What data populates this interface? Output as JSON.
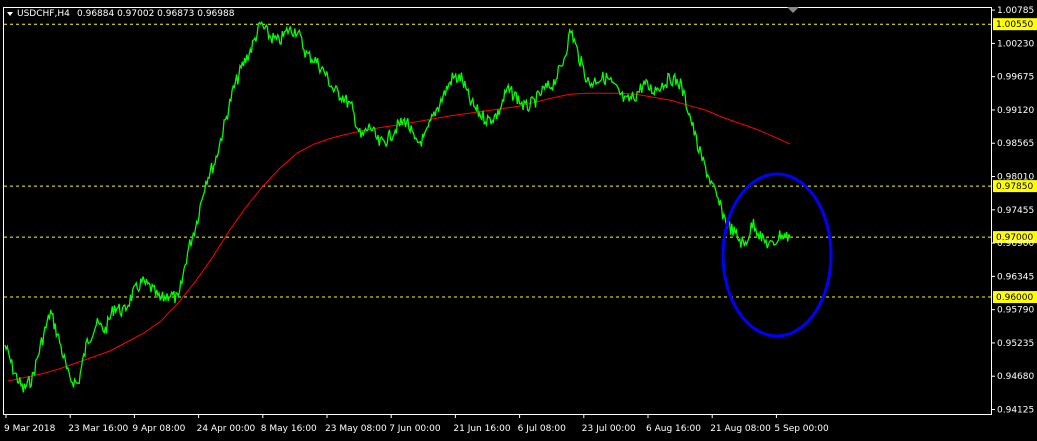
{
  "header": {
    "symbol": "USDCHF,H4",
    "ohlc": "0.96884 0.97002 0.96873 0.96988"
  },
  "colors": {
    "background": "#000000",
    "price": "#00ff00",
    "moving_average": "#ff0000",
    "levels": "#ffff00",
    "level_label_bg": "#ffff00",
    "level_label_text": "#000000",
    "circle": "#0000ff",
    "axis_text": "#ffffff"
  },
  "chart_data": {
    "type": "line",
    "title": "",
    "xlabel": "",
    "ylabel": "",
    "ylim": [
      0.9405,
      1.0082
    ],
    "y_ticks": [
      "1.00785",
      "1.00230",
      "0.99675",
      "0.99120",
      "0.98565",
      "0.98010",
      "0.97455",
      "0.96900",
      "0.96345",
      "0.95790",
      "0.95235",
      "0.94680",
      "0.94125"
    ],
    "x_ticks": [
      "9 Mar 2018",
      "23 Mar 16:00",
      "9 Apr 08:00",
      "24 Apr 00:00",
      "8 May 16:00",
      "23 May 08:00",
      "7 Jun 00:00",
      "21 Jun 16:00",
      "6 Jul 08:00",
      "23 Jul 00:00",
      "6 Aug 16:00",
      "21 Aug 08:00",
      "5 Sep 00:00"
    ],
    "series": [
      {
        "values": [
          0.952,
          0.9475,
          0.9445,
          0.9465,
          0.9525,
          0.9575,
          0.9525,
          0.9465,
          0.9455,
          0.9525,
          0.9555,
          0.9545,
          0.9585,
          0.9575,
          0.9605,
          0.9625,
          0.9615,
          0.9595,
          0.9605,
          0.9595,
          0.9675,
          0.9725,
          0.9795,
          0.9825,
          0.9885,
          0.9945,
          0.9985,
          1.0015,
          1.0055,
          1.0035,
          1.0025,
          1.0045,
          1.0045,
          1.0005,
          0.9995,
          0.9975,
          0.9945,
          0.9935,
          0.9915,
          0.9865,
          0.9885,
          0.9855,
          0.9865,
          0.9885,
          0.9895,
          0.9855,
          0.9865,
          0.9905,
          0.9935,
          0.9965,
          0.9965,
          0.9925,
          0.9905,
          0.9895,
          0.9905,
          0.9945,
          0.9935,
          0.9915,
          0.9925,
          0.9945,
          0.9955,
          0.9985,
          1.0045,
          0.9995,
          0.9955,
          0.9965,
          0.9965,
          0.9945,
          0.9925,
          0.9935,
          0.9955,
          0.9945,
          0.9955,
          0.9965,
          0.9955,
          0.9905,
          0.9845,
          0.9805,
          0.9765,
          0.9725,
          0.9705,
          0.9685,
          0.9725,
          0.9695,
          0.9685,
          0.9705,
          0.9699
        ],
        "color": "#00ff00"
      },
      {
        "values": [
          0.946,
          0.9466,
          0.9472,
          0.948,
          0.949,
          0.95,
          0.951,
          0.9525,
          0.954,
          0.956,
          0.959,
          0.9625,
          0.9665,
          0.971,
          0.975,
          0.9785,
          0.9815,
          0.984,
          0.9855,
          0.9865,
          0.9872,
          0.9878,
          0.9883,
          0.9887,
          0.9892,
          0.9897,
          0.9902,
          0.9906,
          0.991,
          0.9914,
          0.9918,
          0.9925,
          0.9932,
          0.9938,
          0.994,
          0.994,
          0.994,
          0.9938,
          0.9933,
          0.9928,
          0.992,
          0.9912,
          0.99,
          0.989,
          0.988,
          0.9868,
          0.9855
        ],
        "color": "#ff0000"
      }
    ],
    "levels": [
      {
        "value": 1.0055,
        "label": "1.00550",
        "label_box": true
      },
      {
        "value": 0.9785,
        "label": "0.97850",
        "label_box": true
      },
      {
        "value": 0.97,
        "label": "0.97000",
        "label_box": true
      },
      {
        "value": 0.96,
        "label": "0.96000",
        "label_box": true
      }
    ],
    "grid": false
  }
}
